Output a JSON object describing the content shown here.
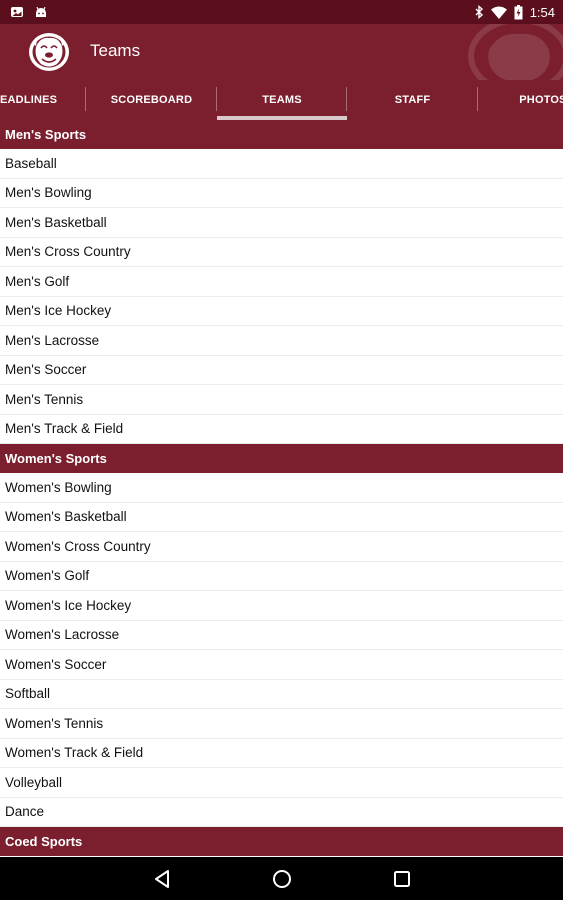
{
  "status_bar": {
    "time": "1:54",
    "left_icons": [
      "photo-notification-icon",
      "android-notification-icon"
    ],
    "right_icons": [
      "bluetooth-icon",
      "wifi-icon",
      "battery-charging-icon"
    ]
  },
  "app_bar": {
    "title": "Teams",
    "logo_icon": "bulldog-logo-icon",
    "background_color": "#7b1f2e"
  },
  "tabs": [
    {
      "label": "EADLINES",
      "active": false
    },
    {
      "label": "SCOREBOARD",
      "active": false
    },
    {
      "label": "TEAMS",
      "active": true
    },
    {
      "label": "STAFF",
      "active": false
    },
    {
      "label": "PHOTOS",
      "active": false
    }
  ],
  "sections": [
    {
      "title": "Men's Sports",
      "items": [
        "Baseball",
        "Men's Bowling",
        "Men's Basketball",
        "Men's Cross Country",
        "Men's Golf",
        "Men's Ice Hockey",
        "Men's Lacrosse",
        "Men's Soccer",
        "Men's Tennis",
        "Men's Track & Field"
      ]
    },
    {
      "title": "Women's Sports",
      "items": [
        "Women's Bowling",
        "Women's Basketball",
        "Women's Cross Country",
        "Women's Golf",
        "Women's Ice Hockey",
        "Women's Lacrosse",
        "Women's Soccer",
        "Softball",
        "Women's Tennis",
        "Women's Track & Field",
        "Volleyball",
        "Dance"
      ]
    },
    {
      "title": "Coed Sports",
      "items": []
    }
  ],
  "nav_bar": {
    "buttons": [
      "back-icon",
      "home-icon",
      "recents-icon"
    ]
  }
}
